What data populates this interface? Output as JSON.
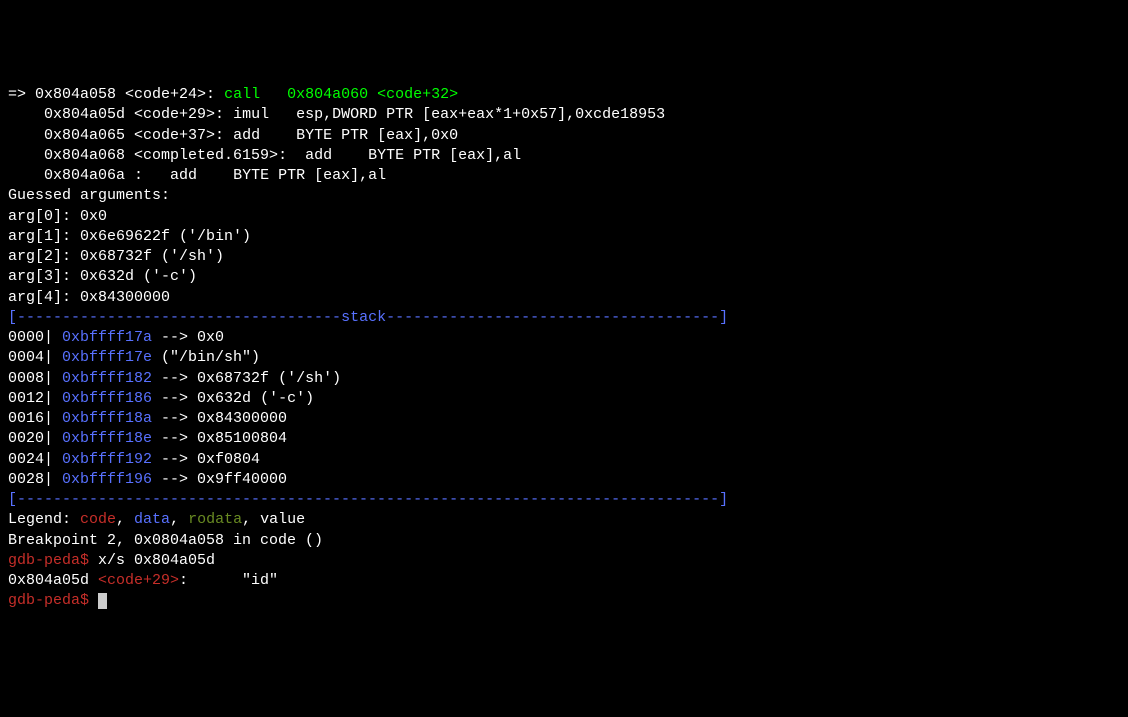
{
  "disasm": [
    {
      "arrow": "=>",
      "addr": "0x804a058",
      "label": "<code+24>",
      "inst_pre": ": ",
      "inst": "call",
      "inst_post": "   ",
      "target": "0x804a060 <code+32>",
      "is_current": true
    },
    {
      "arrow": "   ",
      "addr": "0x804a05d",
      "label": "<code+29>",
      "inst_pre": ": ",
      "inst": "imul",
      "inst_post": "   ",
      "rest": "esp,DWORD PTR [eax+eax*1+0x57],0xcde18953"
    },
    {
      "arrow": "   ",
      "addr": "0x804a065",
      "label": "<code+37>",
      "inst_pre": ": ",
      "inst": "add",
      "inst_post": "    ",
      "rest": "BYTE PTR [eax],0x0"
    },
    {
      "arrow": "   ",
      "addr": "0x804a068",
      "label": "<completed.6159>",
      "inst_pre": ":  ",
      "inst": "add",
      "inst_post": "    ",
      "rest": "BYTE PTR [eax],al"
    },
    {
      "arrow": "   ",
      "addr": "0x804a06a",
      "label": ":   ",
      "inst": "add",
      "inst_post": "    ",
      "rest": "BYTE PTR [eax],al",
      "no_label_brackets": true
    }
  ],
  "guessed_heading": "Guessed arguments:",
  "args": [
    {
      "label": "arg[0]: ",
      "value": "0x0",
      "suffix": ""
    },
    {
      "label": "arg[1]: ",
      "value": "0x6e69622f",
      "suffix": " ('/bin')"
    },
    {
      "label": "arg[2]: ",
      "value": "0x68732f",
      "suffix": " ('/sh')"
    },
    {
      "label": "arg[3]: ",
      "value": "0x632d",
      "suffix": " ('-c')"
    },
    {
      "label": "arg[4]: ",
      "value": "0x84300000",
      "suffix": ""
    }
  ],
  "stack_div_left": "[------------------------------------",
  "stack_div_title": "stack",
  "stack_div_right": "-------------------------------------]",
  "stack": [
    {
      "off": "0000| ",
      "addr": "0xbffff17a",
      "arrow": " --> ",
      "value": "0x0 ",
      "suffix": ""
    },
    {
      "off": "0004| ",
      "addr": "0xbffff17e",
      "arrow": " ",
      "value": "",
      "suffix": "(\"/bin/sh\")"
    },
    {
      "off": "0008| ",
      "addr": "0xbffff182",
      "arrow": " --> ",
      "value": "0x68732f ",
      "suffix": "('/sh')"
    },
    {
      "off": "0012| ",
      "addr": "0xbffff186",
      "arrow": " --> ",
      "value": "0x632d ",
      "suffix": "('-c')"
    },
    {
      "off": "0016| ",
      "addr": "0xbffff18a",
      "arrow": " --> ",
      "value": "0x84300000 ",
      "suffix": ""
    },
    {
      "off": "0020| ",
      "addr": "0xbffff18e",
      "arrow": " --> ",
      "value": "0x85100804 ",
      "suffix": ""
    },
    {
      "off": "0024| ",
      "addr": "0xbffff192",
      "arrow": " --> ",
      "value": "0xf0804 ",
      "suffix": ""
    },
    {
      "off": "0028| ",
      "addr": "0xbffff196",
      "arrow": " --> ",
      "value": "0x9ff40000 ",
      "suffix": ""
    }
  ],
  "bottom_div": "[------------------------------------------------------------------------------]",
  "legend": {
    "pre": "Legend: ",
    "code": "code",
    "sep1": ", ",
    "data": "data",
    "sep2": ", ",
    "rodata": "rodata",
    "sep3": ", ",
    "value": "value"
  },
  "breakpoint": "Breakpoint 2, 0x0804a058 in code ()",
  "prompt": "gdb-peda$",
  "cmd1": " x/s 0x804a05d",
  "result_addr": "0x804a05d ",
  "result_label": "<code+29>",
  "result_rest": ":      \"id\"",
  "cmd2": " "
}
